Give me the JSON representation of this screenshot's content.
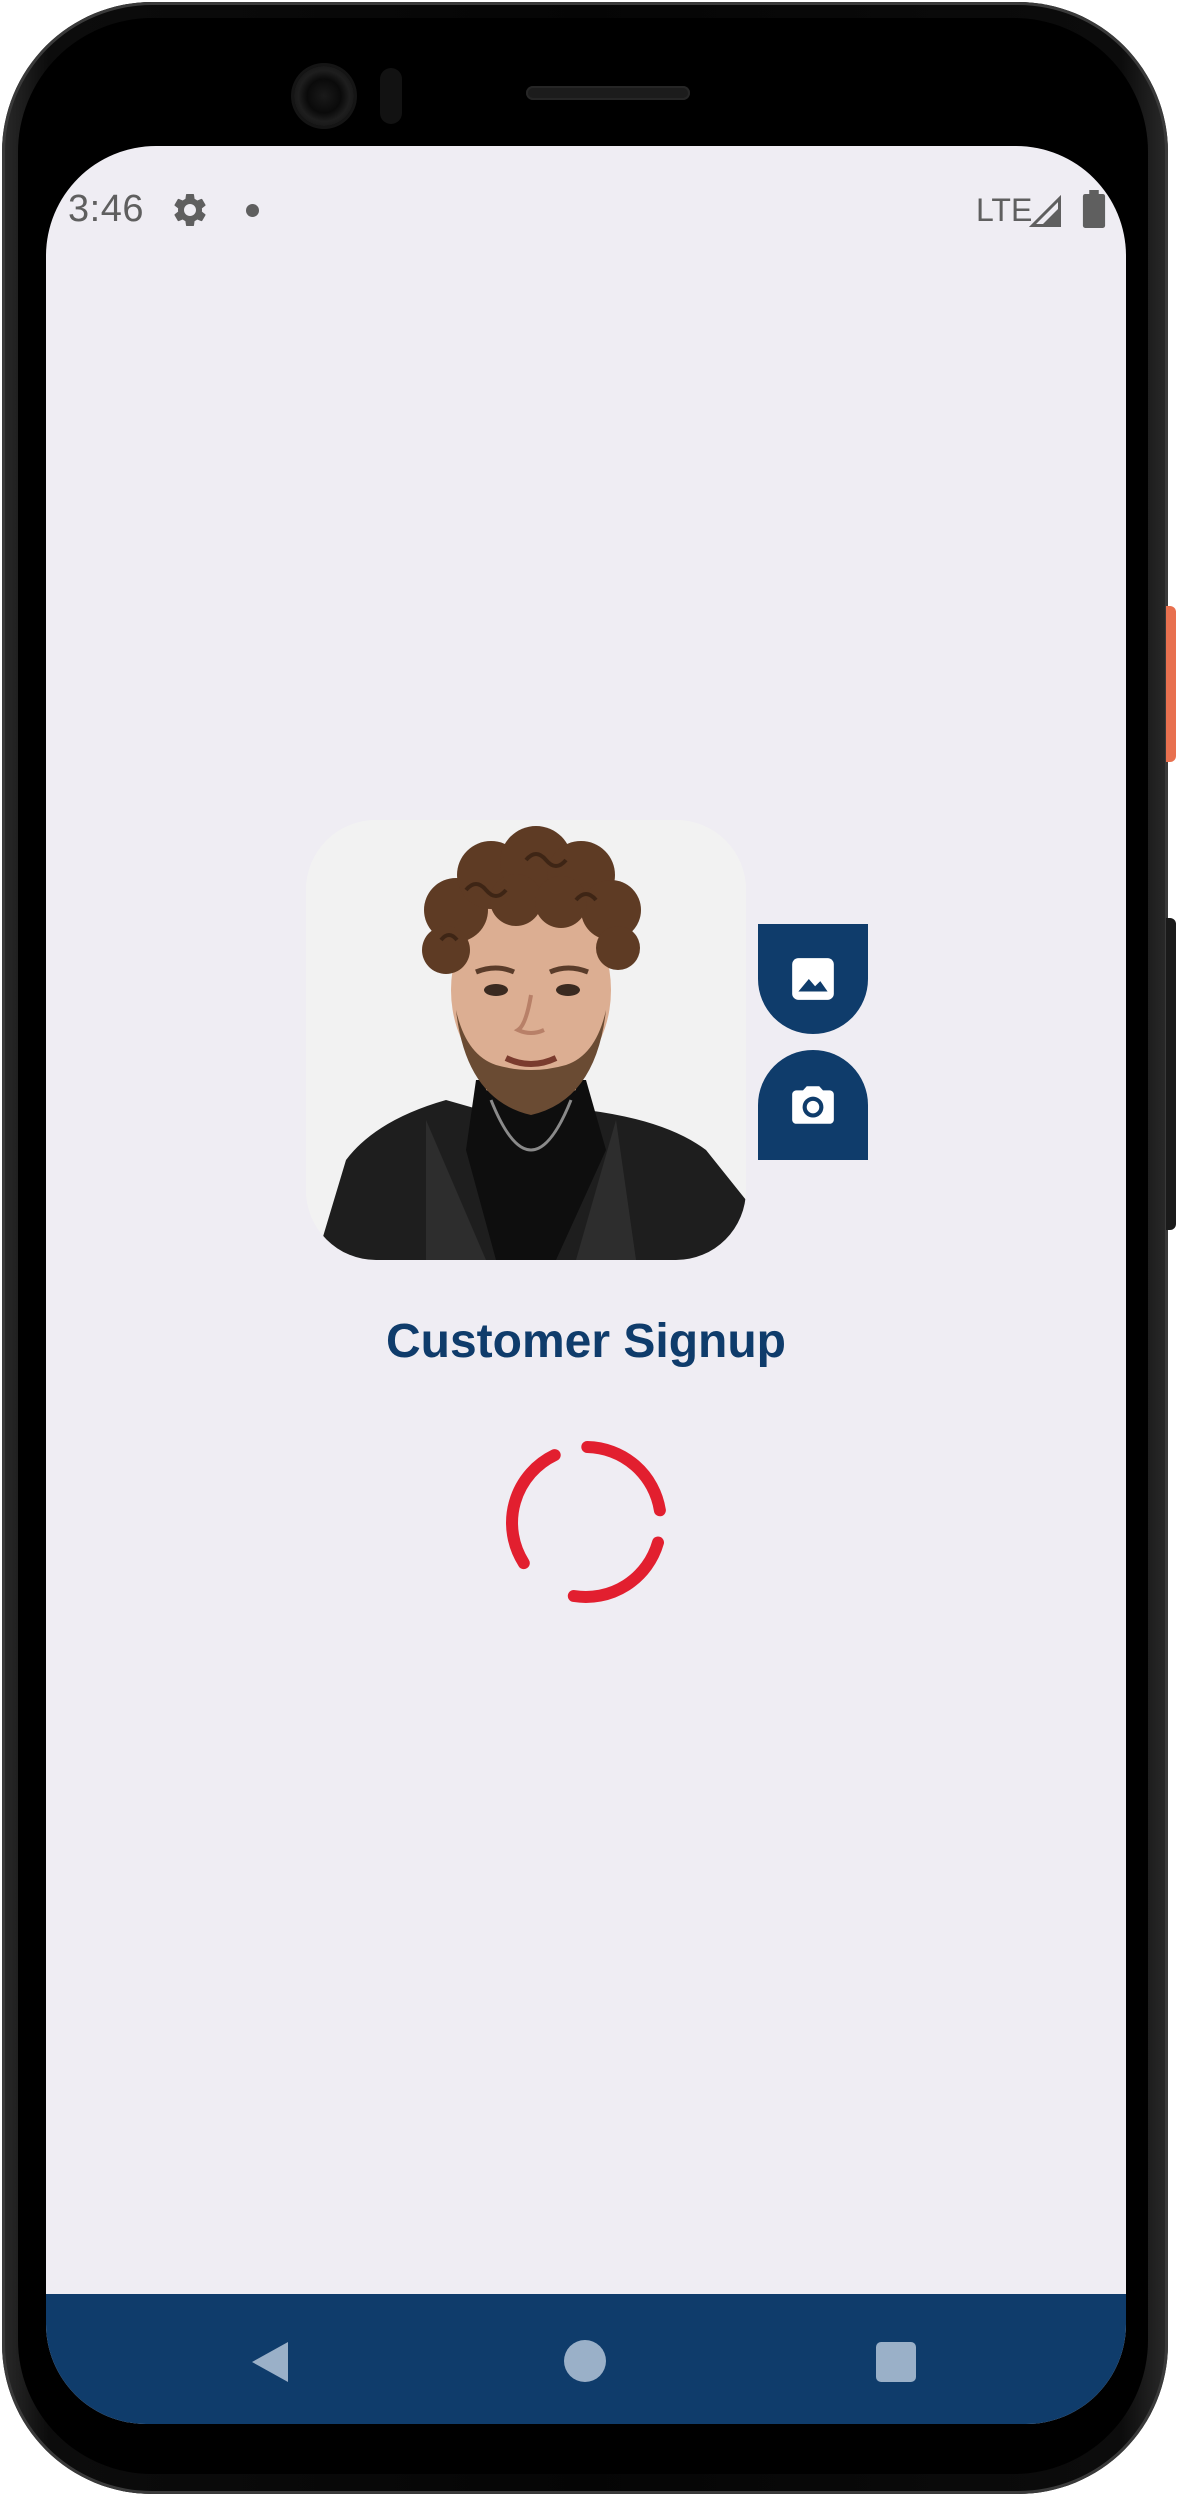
{
  "status_bar": {
    "time": "3:46",
    "network": "LTE",
    "icons": [
      "settings-gear-icon",
      "notification-dot-icon",
      "signal-icon",
      "battery-icon"
    ]
  },
  "profile": {
    "avatar": "profile-photo",
    "gallery_button_icon": "image-gallery-icon",
    "camera_button_icon": "camera-icon"
  },
  "page": {
    "title": "Customer Signup"
  },
  "loader": {
    "icon": "loading-spinner-icon",
    "color": "#e21f2f"
  },
  "navigation": {
    "icons": [
      "back-icon",
      "home-icon",
      "recents-icon"
    ]
  },
  "colors": {
    "primary": "#0f3c6b",
    "accent": "#e21f2f",
    "background": "#efedf3"
  }
}
